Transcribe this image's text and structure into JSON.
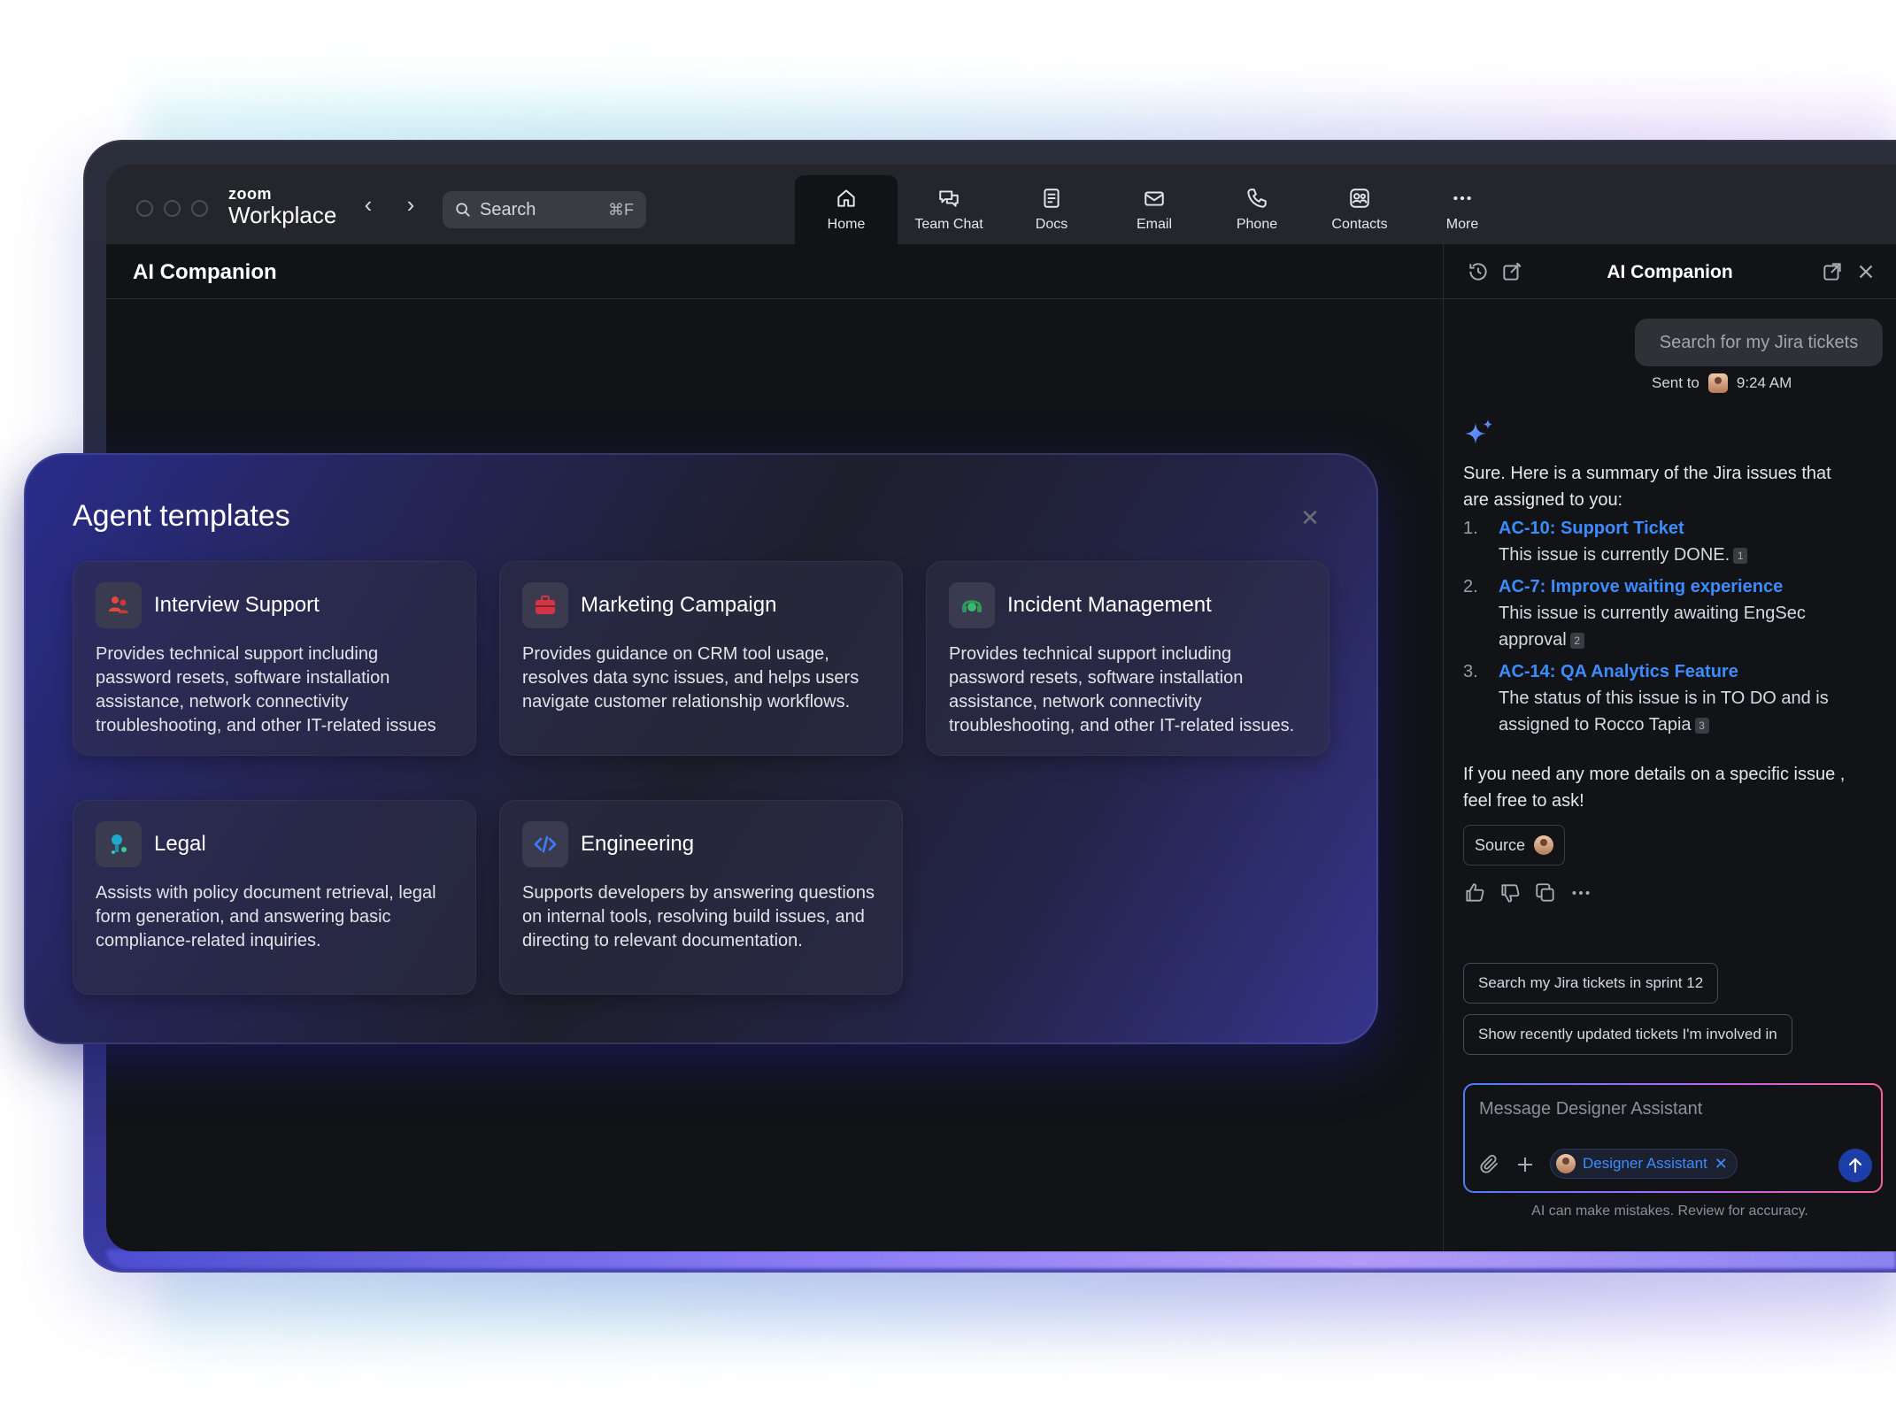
{
  "window": {
    "brand_small": "zoom",
    "brand_big": "Workplace",
    "search_label": "Search",
    "search_shortcut": "⌘F"
  },
  "tabs": [
    {
      "label": "Home",
      "icon": "home-icon",
      "active": true
    },
    {
      "label": "Team Chat",
      "icon": "chat-icon"
    },
    {
      "label": "Docs",
      "icon": "docs-icon"
    },
    {
      "label": "Email",
      "icon": "email-icon"
    },
    {
      "label": "Phone",
      "icon": "phone-icon"
    },
    {
      "label": "Contacts",
      "icon": "contacts-icon"
    },
    {
      "label": "More",
      "icon": "more-icon"
    }
  ],
  "main": {
    "title": "AI Companion"
  },
  "modal": {
    "title": "Agent templates",
    "cards": [
      {
        "title": "Interview Support",
        "icon": "people-icon",
        "icon_color": "#e0493a",
        "desc": "Provides technical support including password resets, software installation assistance, network connectivity troubleshooting, and other IT-related issues"
      },
      {
        "title": "Marketing Campaign",
        "icon": "briefcase-icon",
        "icon_color": "#d23645",
        "desc": "Provides guidance on CRM tool usage, resolves data sync issues, and helps users navigate customer relationship workflows."
      },
      {
        "title": "Incident Management",
        "icon": "headset-icon",
        "icon_color": "#2f9a57",
        "desc": "Provides technical support including password resets, software installation assistance, network connectivity troubleshooting, and other IT-related issues."
      },
      {
        "title": "Legal",
        "icon": "legal-icon",
        "icon_color": "#1fa9c9",
        "desc": "Assists with policy document retrieval, legal form generation, and answering basic compliance-related inquiries."
      },
      {
        "title": "Engineering",
        "icon": "code-icon",
        "icon_color": "#3f7cff",
        "desc": "Supports developers by answering questions on internal tools, resolving build issues, and directing to relevant documentation."
      }
    ]
  },
  "panel": {
    "title": "AI Companion",
    "user_message": "Search for my Jira tickets",
    "sent_to": "Sent to",
    "time": "9:24 AM",
    "reply_intro": "Sure. Here is a summary of the Jira issues that are assigned to you:",
    "issues": [
      {
        "num": "1.",
        "link": "AC-10: Support Ticket",
        "desc": "This issue is currently DONE.",
        "cite": "1"
      },
      {
        "num": "2.",
        "link": "AC-7: Improve waiting experience",
        "desc": "This issue is currently awaiting EngSec approval",
        "cite": "2"
      },
      {
        "num": "3.",
        "link": "AC-14: QA Analytics Feature",
        "desc": "The status of this issue is in TO DO and is assigned to Rocco Tapia",
        "cite": "3"
      }
    ],
    "reply_outro": "If you need any more details on a specific issue , feel free to ask!",
    "source_label": "Source",
    "suggestions": [
      "Search my Jira tickets in sprint 12",
      "Show recently updated tickets I'm involved in"
    ],
    "composer_placeholder": "Message Designer Assistant",
    "chip_label": "Designer Assistant",
    "disclaimer": "AI can make mistakes. Review for accuracy."
  }
}
